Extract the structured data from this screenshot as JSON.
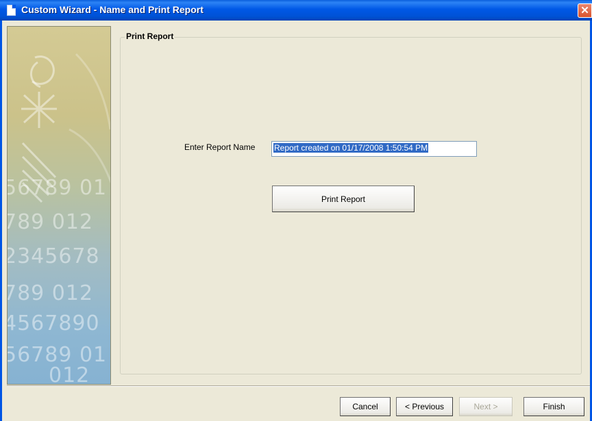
{
  "window": {
    "title": "Custom Wizard - Name and Print Report",
    "close_glyph": "✕"
  },
  "banner": {
    "digit_rows": [
      "56789 01",
      "789 012",
      "2345678",
      "789 012",
      "4567890",
      "56789 01",
      "012"
    ]
  },
  "group": {
    "title": "Print Report",
    "name_label": "Enter Report Name",
    "name_value": "Report created on 01/17/2008 1:50:54 PM",
    "print_button": "Print Report"
  },
  "footer": {
    "cancel": "Cancel",
    "previous": "< Previous",
    "next": "Next >",
    "finish": "Finish"
  },
  "colors": {
    "titlebar": "#0058e6",
    "selection": "#316ac5",
    "dialog_bg": "#ece9d8"
  }
}
